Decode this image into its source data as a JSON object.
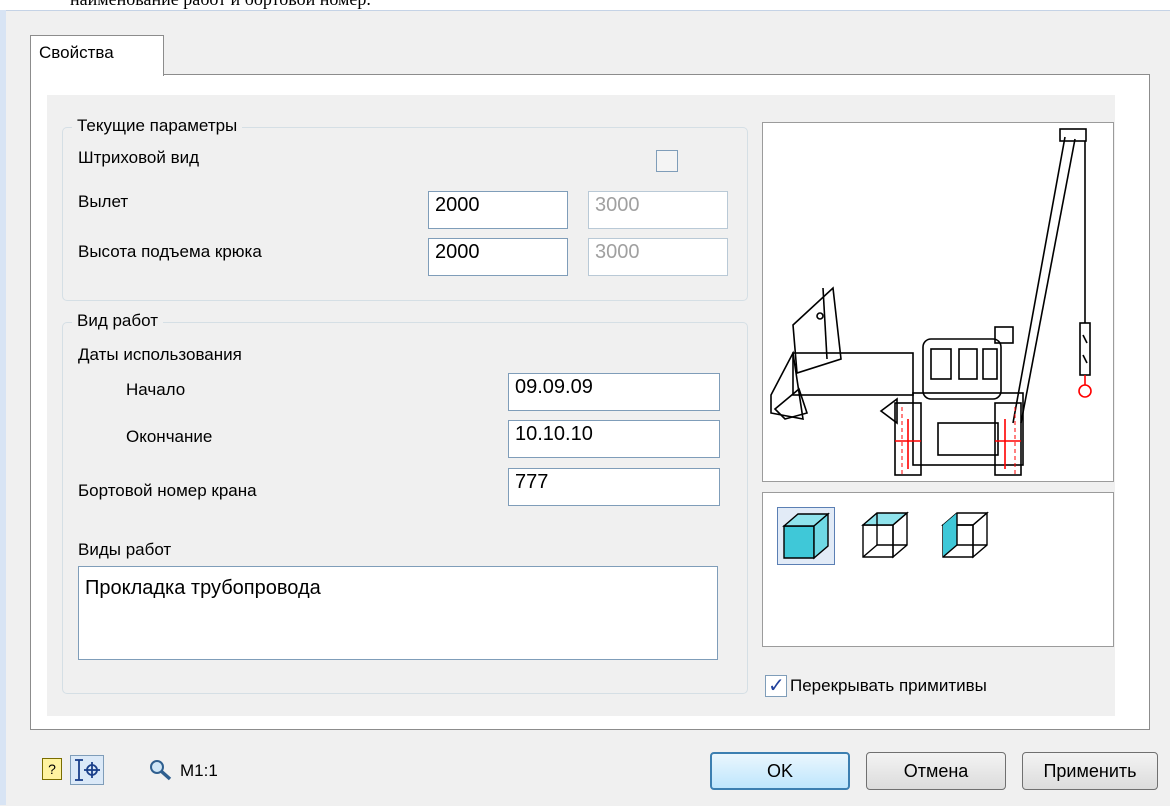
{
  "top_caption": "наименование работ и бортовой номер.",
  "tab": {
    "label": "Свойства"
  },
  "current_params": {
    "title": "Текущие параметры",
    "hatch_label": "Штриховой вид",
    "hatch_checked": false,
    "reach_label": "Вылет",
    "reach_value": "2000",
    "reach_value_disabled": "3000",
    "hook_height_label": "Высота подъема крюка",
    "hook_height_value": "2000",
    "hook_height_value_disabled": "3000"
  },
  "work": {
    "title": "Вид работ",
    "dates_label": "Даты использования",
    "start_label": "Начало",
    "start_value": "09.09.09",
    "end_label": "Окончание",
    "end_value": "10.10.10",
    "crane_number_label": "Бортовой номер крана",
    "crane_number_value": "777",
    "work_types_label": "Виды работ",
    "work_types_value": "Прокладка трубопровода"
  },
  "preview": {
    "view_styles": [
      "solid-cube-icon",
      "wireframe-cube-icon",
      "hidden-line-cube-icon"
    ],
    "overlap_label": "Перекрывать примитивы",
    "overlap_checked": true
  },
  "footer": {
    "scale_label": "M1:1",
    "ok_label": "OK",
    "cancel_label": "Отмена",
    "apply_label": "Применить"
  },
  "colors": {
    "accent": "#3c7fb1",
    "cube_fill": "#3fc8d8",
    "crane_mark": "#ff0000"
  }
}
